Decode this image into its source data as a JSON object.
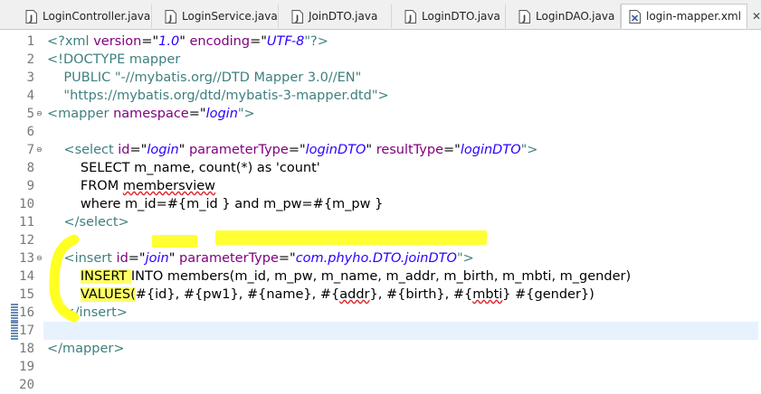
{
  "tabs": [
    {
      "label": "LoginController.java",
      "icon": "java-file-icon",
      "active": false
    },
    {
      "label": "LoginService.java",
      "icon": "java-file-icon",
      "active": false
    },
    {
      "label": "JoinDTO.java",
      "icon": "java-file-icon",
      "active": false
    },
    {
      "label": "LoginDTO.java",
      "icon": "java-file-icon",
      "active": false
    },
    {
      "label": "LoginDAO.java",
      "icon": "java-file-icon",
      "active": false
    },
    {
      "label": "login-mapper.xml",
      "icon": "xml-file-icon",
      "active": true
    }
  ],
  "editor": {
    "line_numbers": [
      "1",
      "2",
      "3",
      "4",
      "5",
      "6",
      "7",
      "8",
      "9",
      "10",
      "11",
      "12",
      "13",
      "14",
      "15",
      "16",
      "17",
      "18",
      "19",
      "20"
    ],
    "lines": {
      "l1": {
        "a": "<?xml ",
        "b": "version",
        "c": "=\"",
        "d": "1.0",
        "e": "\" ",
        "f": "encoding",
        "g": "=\"",
        "h": "UTF-8",
        "i": "\"?>"
      },
      "l2": {
        "a": "<!DOCTYPE mapper"
      },
      "l3": {
        "a": "    PUBLIC \"-//mybatis.org//DTD Mapper 3.0//EN\""
      },
      "l4": {
        "a": "    \"https://mybatis.org/dtd/mybatis-3-mapper.dtd\">"
      },
      "l5": {
        "a": "<mapper ",
        "b": "namespace",
        "c": "=\"",
        "d": "login",
        "e": "\">"
      },
      "l7": {
        "a": "    <select ",
        "b": "id",
        "c": "=\"",
        "d": "login",
        "e": "\" ",
        "f": "parameterType",
        "g": "=\"",
        "h": "loginDTO",
        "i": "\" ",
        "j": "resultType",
        "k": "=\"",
        "l": "loginDTO",
        "m": "\">"
      },
      "l8": {
        "a": "        SELECT m_name, count(*) as 'count'"
      },
      "l9": {
        "a": "        FROM ",
        "b": "membersview"
      },
      "l10": {
        "a": "        where m_id=#{m_id } and m_pw=#{m_pw }"
      },
      "l11": {
        "a": "    </select>"
      },
      "l13": {
        "a": "    <insert ",
        "b": "id",
        "c": "=\"",
        "d": "join",
        "e": "\" ",
        "f": "parameterType",
        "g": "=\"",
        "h": "com.phyho.DTO.joinDTO",
        "i": "\">"
      },
      "l14": {
        "a": "        ",
        "b": "INSERT ",
        "c": "INTO members(m_id, m_pw, m_name, m_addr, m_birth, m_mbti, m_gender)"
      },
      "l15": {
        "a": "        ",
        "b": "VALUES(",
        "c": "#{id}, #{pw1}, #{name}, #{",
        "d": "addr",
        "e": "}, #{birth}, #{",
        "f": "mbti",
        "g": "} #{gender})"
      },
      "l16": {
        "a": "    </insert>"
      },
      "l18": {
        "a": "</mapper>"
      }
    },
    "current_line": 17,
    "fold_markers": [
      5,
      7,
      13
    ]
  },
  "colors": {
    "tag": "#3f7f7f",
    "attribute": "#7f007f",
    "value": "#2a00ff",
    "highlight": "#ffff33",
    "current_line_bg": "#e8f2fe"
  }
}
